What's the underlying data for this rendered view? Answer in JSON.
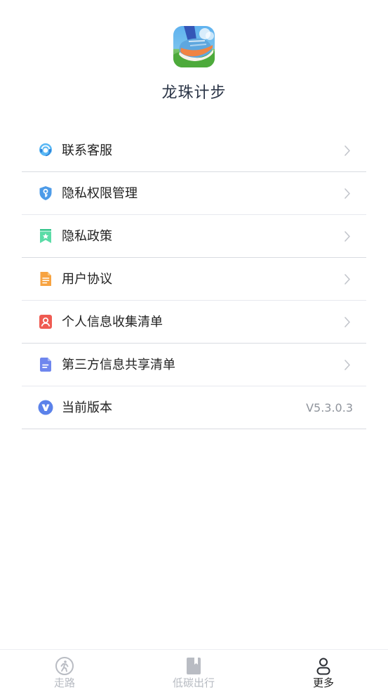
{
  "app": {
    "name": "龙珠计步"
  },
  "menu": {
    "items": [
      {
        "label": "联系客服",
        "icon": "headset-icon"
      },
      {
        "label": "隐私权限管理",
        "icon": "shield-key-icon"
      },
      {
        "label": "隐私政策",
        "icon": "bookmark-star-icon"
      },
      {
        "label": "用户协议",
        "icon": "document-icon"
      },
      {
        "label": "个人信息收集清单",
        "icon": "person-card-icon"
      },
      {
        "label": "第三方信息共享清单",
        "icon": "list-doc-icon"
      },
      {
        "label": "当前版本",
        "icon": "version-v-icon",
        "value": "V5.3.0.3"
      }
    ]
  },
  "tabbar": {
    "tabs": [
      {
        "label": "走路",
        "icon": "walking-person-icon",
        "active": false
      },
      {
        "label": "低碳出行",
        "icon": "book-icon",
        "active": false
      },
      {
        "label": "更多",
        "icon": "user-icon",
        "active": true
      }
    ]
  }
}
